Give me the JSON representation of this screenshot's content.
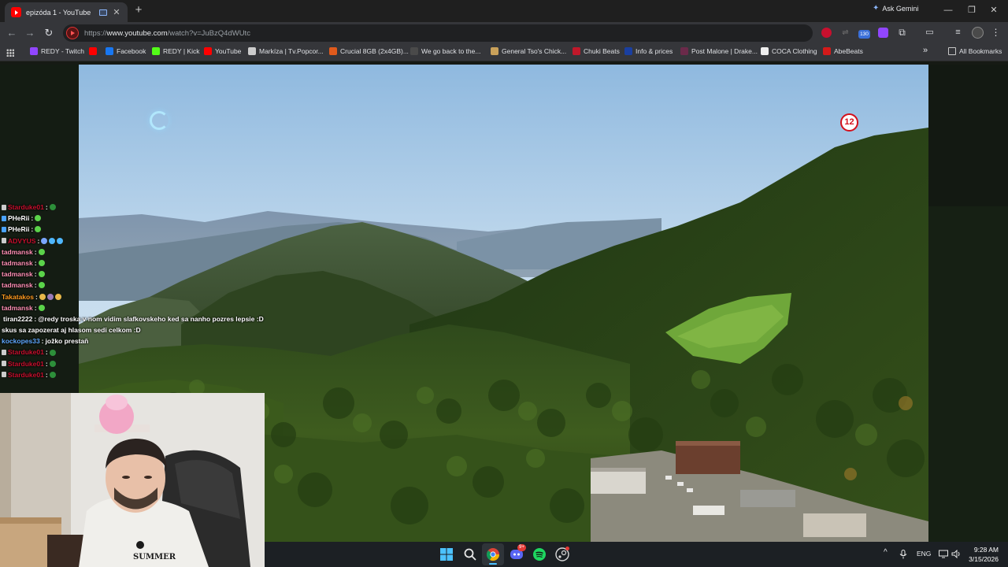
{
  "browser": {
    "tab": {
      "title": "epizóda 1 - YouTube",
      "close": "✕"
    },
    "new_tab": "+",
    "gemini_label": "Ask Gemini",
    "window_controls": {
      "minimize": "—",
      "maximize": "❐",
      "close": "✕"
    },
    "nav": {
      "back": "←",
      "forward": "→",
      "reload": "↻"
    },
    "url": {
      "prefix": "https://",
      "host": "www.youtube.com",
      "path": "/watch?v=JuBzQ4dWUtc"
    },
    "extension_badge": "130",
    "bookmarks": [
      {
        "label": "REDY - Twitch",
        "color": "#9146ff"
      },
      {
        "label": "",
        "color": "#ff0000"
      },
      {
        "label": "Facebook",
        "color": "#1877f2"
      },
      {
        "label": "REDY | Kick",
        "color": "#53fc18"
      },
      {
        "label": "YouTube",
        "color": "#ff0000"
      },
      {
        "label": "Markíza | Tv.Popcor...",
        "color": "#cccccc"
      },
      {
        "label": "Crucial 8GB (2x4GB)...",
        "color": "#e05a1c"
      },
      {
        "label": "We go back to the...",
        "color": "#4a4a4a"
      },
      {
        "label": "General Tso's Chick...",
        "color": "#c9a15a"
      },
      {
        "label": "Chuki Beats",
        "color": "#c0182a"
      },
      {
        "label": "Info & prices",
        "color": "#1a3fa0"
      },
      {
        "label": "Post Malone | Drake...",
        "color": "#6b2a4a"
      },
      {
        "label": "COCA Clothing",
        "color": "#eeeeee"
      },
      {
        "label": "AbeBeats",
        "color": "#d41a1a"
      }
    ],
    "more_bookmarks": "»",
    "all_bookmarks": "All Bookmarks"
  },
  "video": {
    "rating": "12"
  },
  "chat": [
    {
      "user": "Starduke01",
      "color": "#c8102e",
      "msg": "",
      "emotes": [
        "#2d8f3a"
      ],
      "badge": "#cccccc"
    },
    {
      "user": "PHeRii",
      "color": "#ffffff",
      "msg": "",
      "emotes": [
        "#5bd34a"
      ],
      "badge": "#4aa3ff"
    },
    {
      "user": "PHeRii",
      "color": "#ffffff",
      "msg": "",
      "emotes": [
        "#5bd34a"
      ],
      "badge": "#4aa3ff"
    },
    {
      "user": "ADVYUS",
      "color": "#c8102e",
      "msg": "",
      "emotes": [
        "#7aa6ff",
        "#4fb7ff",
        "#4fb7ff"
      ],
      "badge": "#cccccc"
    },
    {
      "user": "tadmansk",
      "color": "#ff8fb4",
      "msg": "",
      "emotes": [
        "#5bd34a"
      ],
      "badge": ""
    },
    {
      "user": "tadmansk",
      "color": "#ff8fb4",
      "msg": "",
      "emotes": [
        "#5bd34a"
      ],
      "badge": ""
    },
    {
      "user": "tadmansk",
      "color": "#ff8fb4",
      "msg": "",
      "emotes": [
        "#5bd34a"
      ],
      "badge": ""
    },
    {
      "user": "tadmansk",
      "color": "#ff8fb4",
      "msg": "",
      "emotes": [
        "#5bd34a"
      ],
      "badge": ""
    },
    {
      "user": "Takatakos",
      "color": "#ff9a1f",
      "msg": "",
      "emotes": [
        "#e8b84a",
        "#9a7ab8",
        "#e8b84a"
      ],
      "badge": ""
    },
    {
      "user": "tadmansk",
      "color": "#ff8fb4",
      "msg": "",
      "emotes": [
        "#5bd34a"
      ],
      "badge": ""
    },
    {
      "user": "tiran2222",
      "color": "#ffffff",
      "msg": "@redy troska v nom vidim slafkovskeho ked sa nanho pozres lepsie :D",
      "emotes": [],
      "badge": "#5bd34a"
    },
    {
      "user": "",
      "color": "#ffffff",
      "msg": "skus sa zapozerat aj hlasom sedi celkom :D",
      "emotes": [],
      "badge": ""
    },
    {
      "user": "kockopes33",
      "color": "#5fa8ff",
      "msg": "jožko prestaň",
      "emotes": [],
      "badge": ""
    },
    {
      "user": "Starduke01",
      "color": "#c8102e",
      "msg": "",
      "emotes": [
        "#2d8f3a"
      ],
      "badge": "#cccccc"
    },
    {
      "user": "Starduke01",
      "color": "#c8102e",
      "msg": "",
      "emotes": [
        "#2d8f3a"
      ],
      "badge": "#cccccc"
    },
    {
      "user": "Starduke01",
      "color": "#c8102e",
      "msg": "",
      "emotes": [
        "#2d8f3a"
      ],
      "badge": "#cccccc"
    }
  ],
  "taskbar": {
    "discord_badge": "9+",
    "tray": {
      "expand": "^",
      "lang": "ENG"
    },
    "time": "9:28 AM",
    "date": "3/15/2026"
  },
  "webcam": {
    "shirt_text": "SUMMER"
  }
}
